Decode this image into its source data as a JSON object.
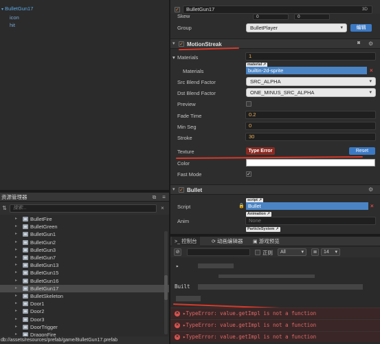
{
  "hierarchy": {
    "items": [
      {
        "label": "BulletGun17",
        "selected": true
      },
      {
        "label": "icon"
      },
      {
        "label": "hit"
      }
    ]
  },
  "assets": {
    "title": "资源管理器",
    "search_placeholder": "搜索...",
    "items": [
      "BulletFire",
      "BulletGreen",
      "BulletGun1",
      "BulletGun2",
      "BulletGun3",
      "BulletGun7",
      "BulletGun13",
      "BulletGun15",
      "BulletGun16",
      "BulletGun17",
      "BulletSkeleton",
      "Door1",
      "Door2",
      "Door3",
      "DoorTrigger",
      "DragonFire"
    ],
    "selected": "BulletGun17",
    "status_path": "db://assets/resources/prefab/game/BulletGun17.prefab"
  },
  "inspector": {
    "top_name": "BulletGun17",
    "top_badge": "3D",
    "skew_label": "Skew",
    "skew_values": [
      "0",
      "0"
    ],
    "group_label": "Group",
    "group_value": "BulletPlayer",
    "edit_button": "编辑",
    "motion_streak": {
      "title": "MotionStreak",
      "materials_label": "Materials",
      "materials_count": "1",
      "material_tag": "material",
      "materials_item_label": "Materials",
      "materials_item_value": "builtin-2d-sprite",
      "src_label": "Src Blend Factor",
      "src_value": "SRC_ALPHA",
      "dst_label": "Dst Blend Factor",
      "dst_value": "ONE_MINUS_SRC_ALPHA",
      "preview_label": "Preview",
      "fade_label": "Fade Time",
      "fade_value": "0.2",
      "minseg_label": "Min Seg",
      "minseg_value": "0",
      "stroke_label": "Stroke",
      "stroke_value": "30",
      "texture_label": "Texture",
      "texture_value": "Type Error",
      "reset_button": "Reset",
      "color_label": "Color",
      "fastmode_label": "Fast Mode",
      "fastmode_checked": true
    },
    "bullet": {
      "title": "Bullet",
      "script_tag": "script",
      "script_label": "Script",
      "script_value": "Bullet",
      "anim_label": "Anim",
      "anim_tag": "Animation",
      "anim_value": "None",
      "particle_tag": "ParticleSystem"
    }
  },
  "console": {
    "tabs": [
      "控制台",
      "动画编辑器",
      "游戏预览"
    ],
    "regex_label": "正则",
    "filter_value": "All",
    "font_size": "14",
    "errors": [
      "TypeError: value.getImpl is not a function",
      "TypeError: value.getImpl is not a function",
      "TypeError: value.getImpl is not a function"
    ],
    "blurred_prefix": "Built "
  },
  "colors": {
    "accent_blue": "#3b79c4",
    "error_red": "#e06a6a",
    "annotation_red": "#d83a2a",
    "field_orange": "#f0b25a"
  }
}
